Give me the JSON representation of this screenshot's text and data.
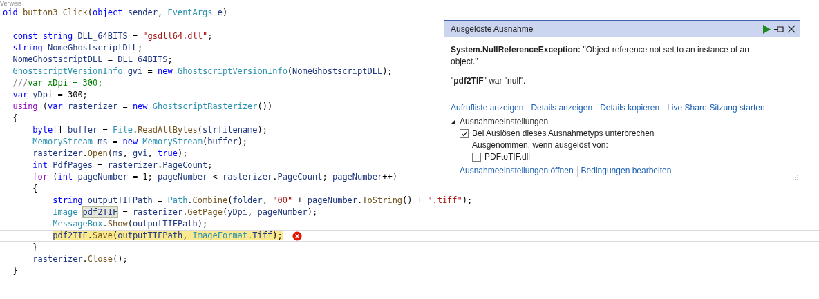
{
  "editor": {
    "codelens": "Verweis",
    "lines": [
      {
        "kind": "code",
        "current": false,
        "tokens": [
          {
            "kind": "keyword",
            "text": "oid"
          },
          {
            "kind": "method",
            "text": " button3_Click"
          },
          {
            "kind": "plain",
            "text": "("
          },
          {
            "kind": "keyword",
            "text": "object"
          },
          {
            "kind": "variable",
            "text": " sender"
          },
          {
            "kind": "plain",
            "text": ", "
          },
          {
            "kind": "type",
            "text": "EventArgs"
          },
          {
            "kind": "variable",
            "text": " e"
          },
          {
            "kind": "plain",
            "text": ")"
          }
        ]
      },
      {
        "kind": "blank"
      },
      {
        "kind": "code",
        "current": false,
        "tokens": [
          {
            "kind": "keyword",
            "text": "  const"
          },
          {
            "kind": "keyword",
            "text": " string"
          },
          {
            "kind": "variable",
            "text": " DLL_64BITS"
          },
          {
            "kind": "plain",
            "text": " = "
          },
          {
            "kind": "string",
            "text": "\"gsdll64.dll\""
          },
          {
            "kind": "plain",
            "text": ";"
          }
        ]
      },
      {
        "kind": "code",
        "current": false,
        "tokens": [
          {
            "kind": "keyword",
            "text": "  string"
          },
          {
            "kind": "variable",
            "text": " NomeGhostscriptDLL"
          },
          {
            "kind": "plain",
            "text": ";"
          }
        ]
      },
      {
        "kind": "code",
        "current": false,
        "tokens": [
          {
            "kind": "variable",
            "text": "  NomeGhostscriptDLL"
          },
          {
            "kind": "plain",
            "text": " = "
          },
          {
            "kind": "variable",
            "text": "DLL_64BITS"
          },
          {
            "kind": "plain",
            "text": ";"
          }
        ]
      },
      {
        "kind": "code",
        "current": false,
        "tokens": [
          {
            "kind": "type",
            "text": "  GhostscriptVersionInfo"
          },
          {
            "kind": "variable",
            "text": " gvi"
          },
          {
            "kind": "plain",
            "text": " = "
          },
          {
            "kind": "keyword",
            "text": "new"
          },
          {
            "kind": "type",
            "text": " GhostscriptVersionInfo"
          },
          {
            "kind": "plain",
            "text": "("
          },
          {
            "kind": "variable",
            "text": "NomeGhostscriptDLL"
          },
          {
            "kind": "plain",
            "text": ");"
          }
        ]
      },
      {
        "kind": "code",
        "current": false,
        "tokens": [
          {
            "kind": "doc",
            "text": "  ///"
          },
          {
            "kind": "comment",
            "text": "var xDpi = 300;"
          }
        ]
      },
      {
        "kind": "code",
        "current": false,
        "tokens": [
          {
            "kind": "keyword",
            "text": "  var"
          },
          {
            "kind": "variable",
            "text": " yDpi"
          },
          {
            "kind": "plain",
            "text": " = 300;"
          }
        ]
      },
      {
        "kind": "code",
        "current": false,
        "tokens": [
          {
            "kind": "control",
            "text": "  using"
          },
          {
            "kind": "plain",
            "text": " ("
          },
          {
            "kind": "keyword",
            "text": "var"
          },
          {
            "kind": "variable",
            "text": " rasterizer"
          },
          {
            "kind": "plain",
            "text": " = "
          },
          {
            "kind": "keyword",
            "text": "new"
          },
          {
            "kind": "type",
            "text": " GhostscriptRasterizer"
          },
          {
            "kind": "plain",
            "text": "())"
          }
        ]
      },
      {
        "kind": "code",
        "current": false,
        "tokens": [
          {
            "kind": "plain",
            "text": "  {"
          }
        ]
      },
      {
        "kind": "code",
        "current": false,
        "tokens": [
          {
            "kind": "keyword",
            "text": "      byte"
          },
          {
            "kind": "plain",
            "text": "[] "
          },
          {
            "kind": "variable",
            "text": "buffer"
          },
          {
            "kind": "plain",
            "text": " = "
          },
          {
            "kind": "type",
            "text": "File"
          },
          {
            "kind": "plain",
            "text": "."
          },
          {
            "kind": "method",
            "text": "ReadAllBytes"
          },
          {
            "kind": "plain",
            "text": "("
          },
          {
            "kind": "variable",
            "text": "strfilename"
          },
          {
            "kind": "plain",
            "text": ");"
          }
        ]
      },
      {
        "kind": "code",
        "current": false,
        "tokens": [
          {
            "kind": "type",
            "text": "      MemoryStream"
          },
          {
            "kind": "variable",
            "text": " ms"
          },
          {
            "kind": "plain",
            "text": " = "
          },
          {
            "kind": "keyword",
            "text": "new"
          },
          {
            "kind": "type",
            "text": " MemoryStream"
          },
          {
            "kind": "plain",
            "text": "("
          },
          {
            "kind": "variable",
            "text": "buffer"
          },
          {
            "kind": "plain",
            "text": ");"
          }
        ]
      },
      {
        "kind": "code",
        "current": false,
        "tokens": [
          {
            "kind": "variable",
            "text": "      rasterizer"
          },
          {
            "kind": "plain",
            "text": "."
          },
          {
            "kind": "method",
            "text": "Open"
          },
          {
            "kind": "plain",
            "text": "("
          },
          {
            "kind": "variable",
            "text": "ms"
          },
          {
            "kind": "plain",
            "text": ", "
          },
          {
            "kind": "variable",
            "text": "gvi"
          },
          {
            "kind": "plain",
            "text": ", "
          },
          {
            "kind": "keyword",
            "text": "true"
          },
          {
            "kind": "plain",
            "text": ");"
          }
        ]
      },
      {
        "kind": "code",
        "current": false,
        "tokens": [
          {
            "kind": "keyword",
            "text": "      int"
          },
          {
            "kind": "variable",
            "text": " PdfPages"
          },
          {
            "kind": "plain",
            "text": " = "
          },
          {
            "kind": "variable",
            "text": "rasterizer"
          },
          {
            "kind": "plain",
            "text": "."
          },
          {
            "kind": "variable",
            "text": "PageCount"
          },
          {
            "kind": "plain",
            "text": ";"
          }
        ]
      },
      {
        "kind": "code",
        "current": false,
        "tokens": [
          {
            "kind": "control",
            "text": "      for"
          },
          {
            "kind": "plain",
            "text": " ("
          },
          {
            "kind": "keyword",
            "text": "int"
          },
          {
            "kind": "variable",
            "text": " pageNumber"
          },
          {
            "kind": "plain",
            "text": " = 1; "
          },
          {
            "kind": "variable",
            "text": "pageNumber"
          },
          {
            "kind": "plain",
            "text": " < "
          },
          {
            "kind": "variable",
            "text": "rasterizer"
          },
          {
            "kind": "plain",
            "text": "."
          },
          {
            "kind": "variable",
            "text": "PageCount"
          },
          {
            "kind": "plain",
            "text": "; "
          },
          {
            "kind": "variable",
            "text": "pageNumber"
          },
          {
            "kind": "plain",
            "text": "++)"
          }
        ]
      },
      {
        "kind": "code",
        "current": false,
        "tokens": [
          {
            "kind": "plain",
            "text": "      {"
          }
        ]
      },
      {
        "kind": "code",
        "current": false,
        "tokens": [
          {
            "kind": "keyword",
            "text": "          string"
          },
          {
            "kind": "variable",
            "text": " outputTIFPath"
          },
          {
            "kind": "plain",
            "text": " = "
          },
          {
            "kind": "type",
            "text": "Path"
          },
          {
            "kind": "plain",
            "text": "."
          },
          {
            "kind": "method",
            "text": "Combine"
          },
          {
            "kind": "plain",
            "text": "("
          },
          {
            "kind": "variable",
            "text": "folder"
          },
          {
            "kind": "plain",
            "text": ", "
          },
          {
            "kind": "string",
            "text": "\"00\""
          },
          {
            "kind": "plain",
            "text": " + "
          },
          {
            "kind": "variable",
            "text": "pageNumber"
          },
          {
            "kind": "plain",
            "text": "."
          },
          {
            "kind": "method",
            "text": "ToString"
          },
          {
            "kind": "plain",
            "text": "() + "
          },
          {
            "kind": "string",
            "text": "\".tiff\""
          },
          {
            "kind": "plain",
            "text": ");"
          }
        ]
      },
      {
        "kind": "code",
        "current": false,
        "tokens": [
          {
            "kind": "type",
            "text": "          Image "
          },
          {
            "kind": "reference",
            "text": "pdf2TIF"
          },
          {
            "kind": "plain",
            "text": " = "
          },
          {
            "kind": "variable",
            "text": "rasterizer"
          },
          {
            "kind": "plain",
            "text": "."
          },
          {
            "kind": "method",
            "text": "GetPage"
          },
          {
            "kind": "plain",
            "text": "("
          },
          {
            "kind": "variable",
            "text": "yDpi"
          },
          {
            "kind": "plain",
            "text": ", "
          },
          {
            "kind": "variable",
            "text": "pageNumber"
          },
          {
            "kind": "plain",
            "text": ");"
          }
        ]
      },
      {
        "kind": "code",
        "current": false,
        "tokens": [
          {
            "kind": "type",
            "text": "          MessageBox"
          },
          {
            "kind": "plain",
            "text": "."
          },
          {
            "kind": "method",
            "text": "Show"
          },
          {
            "kind": "plain",
            "text": "("
          },
          {
            "kind": "variable",
            "text": "outputTIFPath"
          },
          {
            "kind": "plain",
            "text": ");"
          }
        ]
      },
      {
        "kind": "error",
        "current": true,
        "tokens": [
          {
            "kind": "variable",
            "text": "          pdf2TIF"
          },
          {
            "kind": "plain",
            "text": "."
          },
          {
            "kind": "method",
            "text": "Save"
          },
          {
            "kind": "plain",
            "text": "("
          },
          {
            "kind": "variable",
            "text": "outputTIFPath"
          },
          {
            "kind": "plain",
            "text": ", "
          },
          {
            "kind": "type",
            "text": "ImageFormat"
          },
          {
            "kind": "plain",
            "text": "."
          },
          {
            "kind": "variable",
            "text": "Tiff"
          },
          {
            "kind": "plain",
            "text": ");"
          }
        ]
      },
      {
        "kind": "code",
        "current": false,
        "tokens": [
          {
            "kind": "plain",
            "text": "      }"
          }
        ]
      },
      {
        "kind": "code",
        "current": false,
        "tokens": [
          {
            "kind": "variable",
            "text": "      rasterizer"
          },
          {
            "kind": "plain",
            "text": "."
          },
          {
            "kind": "method",
            "text": "Close"
          },
          {
            "kind": "plain",
            "text": "();"
          }
        ]
      },
      {
        "kind": "code",
        "current": false,
        "tokens": [
          {
            "kind": "plain",
            "text": "  }"
          }
        ]
      }
    ]
  },
  "exception_popup": {
    "title": "Ausgelöste Ausnahme",
    "message": "**System.NullReferenceException:** \"Object reference not set to an instance of an object.\"",
    "detail": "\"**pdf2TIF**\" war \"null\".",
    "links": [
      "Aufrufliste anzeigen",
      "Details anzeigen",
      "Details kopieren",
      "Live Share-Sitzung starten"
    ],
    "settings": {
      "title": "Ausnahmeeinstellungen",
      "expanded": true,
      "break_option": {
        "label": "Bei Auslösen dieses Ausnahmetyps unterbrechen",
        "checked": true
      },
      "except_label": "Ausgenommen, wenn ausgelöst von:",
      "modules": [
        {
          "label": "PDFtoTIF.dll",
          "checked": false
        }
      ],
      "links": [
        "Ausnahmeeinstellungen öffnen",
        "Bedingungen bearbeiten"
      ]
    }
  }
}
